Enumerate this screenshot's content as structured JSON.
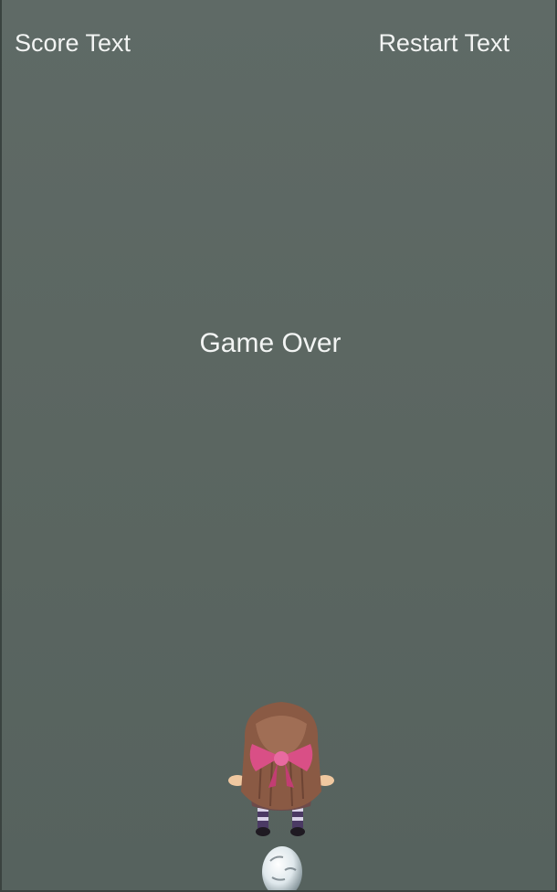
{
  "hud": {
    "score_label": "Score Text",
    "restart_label": "Restart Text"
  },
  "overlay": {
    "game_over_label": "Game Over"
  },
  "scene": {
    "player": "girl-character",
    "obstacle": "egg-sprite"
  },
  "colors": {
    "background": "#5b6661",
    "text": "#f2f4f3",
    "hair": "#8a5a44",
    "bow": "#d94f86"
  }
}
